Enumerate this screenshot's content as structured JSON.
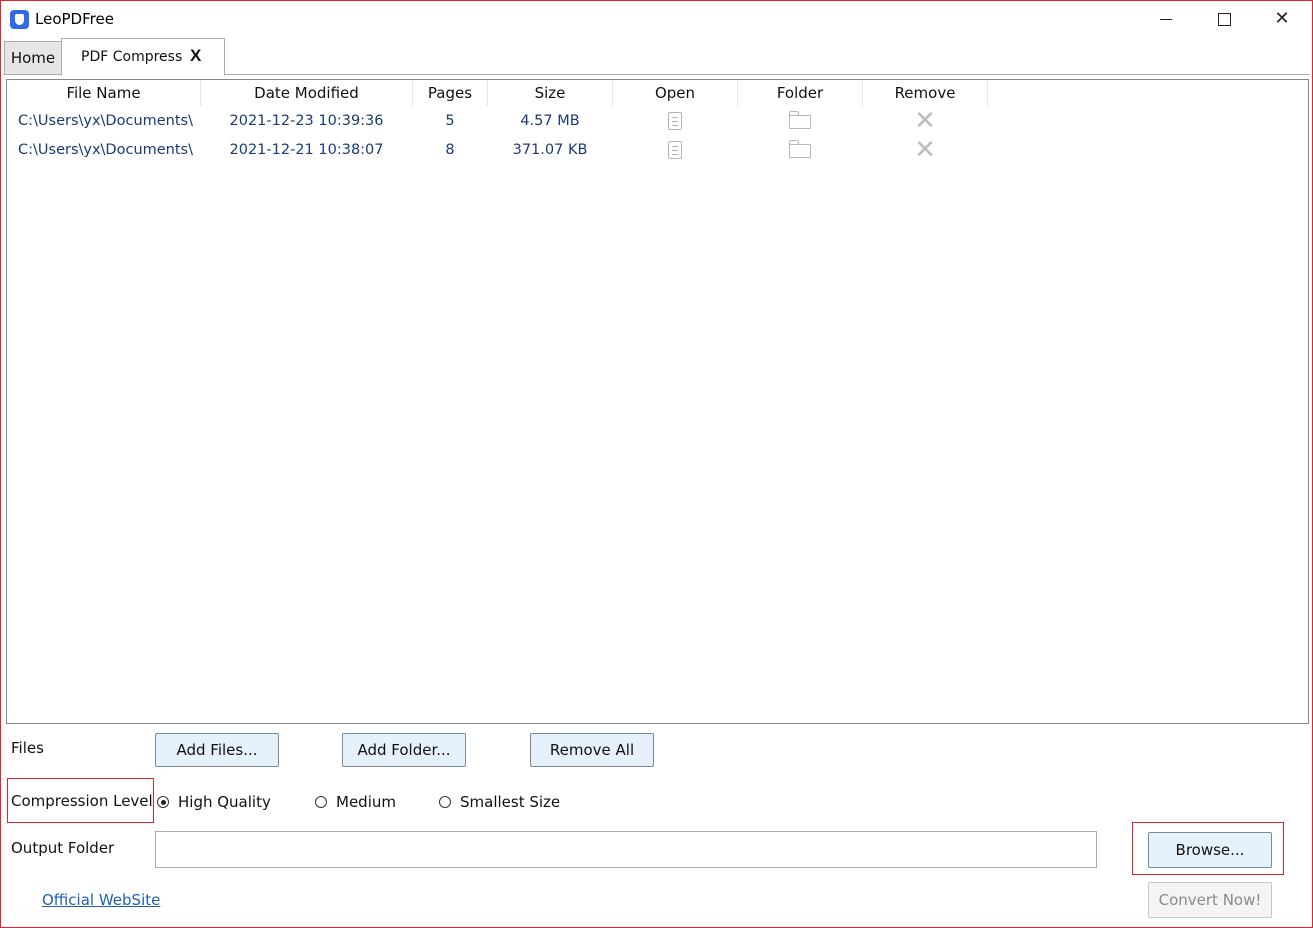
{
  "window": {
    "title": "LeoPDFree",
    "controls": {
      "minimize": "minimize-icon",
      "maximize": "maximize-icon",
      "close": "✕"
    }
  },
  "tabs": [
    {
      "label": "Home",
      "active": false
    },
    {
      "label": "PDF Compress",
      "active": true,
      "close_label": "X"
    }
  ],
  "table": {
    "columns": [
      "File Name",
      "Date Modified",
      "Pages",
      "Size",
      "Open",
      "Folder",
      "Remove"
    ],
    "rows": [
      {
        "file_name": "C:\\Users\\yx\\Documents\\",
        "date_modified": "2021-12-23 10:39:36",
        "pages": "5",
        "size": "4.57 MB"
      },
      {
        "file_name": "C:\\Users\\yx\\Documents\\",
        "date_modified": "2021-12-21 10:38:07",
        "pages": "8",
        "size": "371.07 KB"
      }
    ],
    "row_icons": {
      "open": "document-icon",
      "folder": "folder-icon",
      "remove": "✕"
    }
  },
  "files": {
    "label": "Files",
    "add_files": "Add Files...",
    "add_folder": "Add Folder...",
    "remove_all": "Remove All"
  },
  "compression": {
    "label": "Compression Level",
    "options": [
      "High Quality",
      "Medium",
      "Smallest Size"
    ],
    "selected": "High Quality"
  },
  "output": {
    "label": "Output Folder",
    "value": "",
    "browse": "Browse..."
  },
  "footer": {
    "website_link": "Official WebSite",
    "convert": "Convert Now!"
  },
  "colors": {
    "highlight_border": "#e0262c",
    "row_text": "#1a3a7a",
    "button_bg": "#e5f1fb",
    "link": "#1f5fb8"
  }
}
